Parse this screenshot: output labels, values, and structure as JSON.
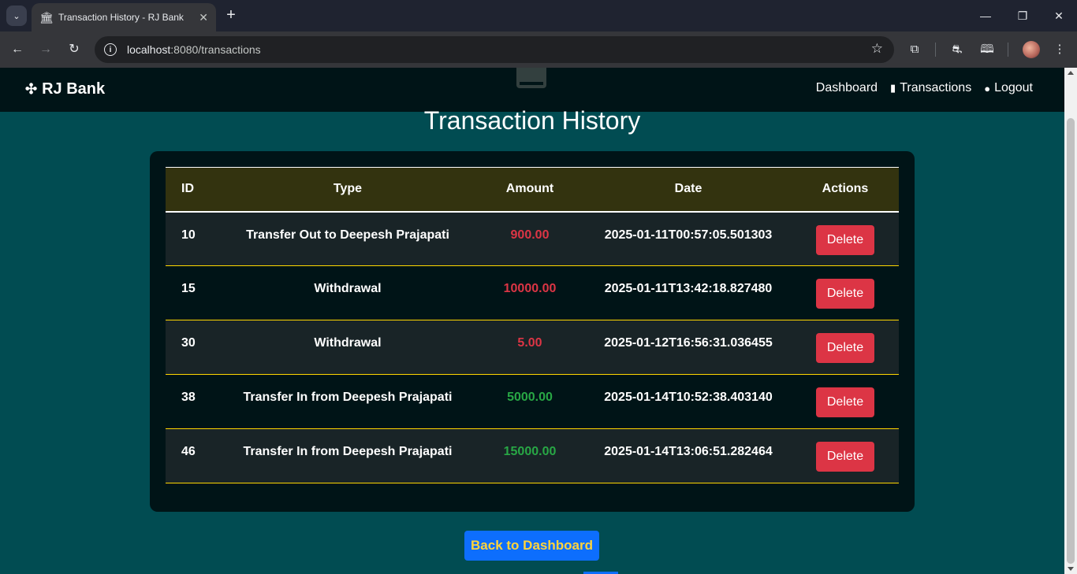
{
  "browser": {
    "tab_title": "Transaction History - RJ Bank",
    "url_host": "localhost",
    "url_rest": ":8080/transactions"
  },
  "navbar": {
    "brand": "RJ Bank",
    "links": {
      "dashboard": "Dashboard",
      "transactions": "Transactions",
      "logout": "Logout"
    }
  },
  "page": {
    "title": "Transaction History"
  },
  "table": {
    "headers": {
      "id": "ID",
      "type": "Type",
      "amount": "Amount",
      "date": "Date",
      "actions": "Actions"
    },
    "rows": [
      {
        "id": "10",
        "type": "Transfer Out to Deepesh Prajapati",
        "amount": "900.00",
        "date": "2025-01-11T00:57:05.501303",
        "action": "Delete"
      },
      {
        "id": "15",
        "type": "Withdrawal",
        "amount": "10000.00",
        "date": "2025-01-11T13:42:18.827480",
        "action": "Delete"
      },
      {
        "id": "30",
        "type": "Withdrawal",
        "amount": "5.00",
        "date": "2025-01-12T16:56:31.036455",
        "action": "Delete"
      },
      {
        "id": "38",
        "type": "Transfer In from Deepesh Prajapati",
        "amount": "5000.00",
        "date": "2025-01-14T10:52:38.403140",
        "action": "Delete"
      },
      {
        "id": "46",
        "type": "Transfer In from Deepesh Prajapati",
        "amount": "15000.00",
        "date": "2025-01-14T13:06:51.282464",
        "action": "Delete"
      }
    ]
  },
  "footer": {
    "back_label": "Back to Dashboard"
  },
  "colors": {
    "page_bg": "#014c52",
    "navbar_bg": "#001417",
    "card_bg": "#001417",
    "header_row_bg": "#33330f",
    "negative": "#dc3545",
    "positive": "#28a745",
    "delete_button": "#dc3545",
    "back_button": "#0d6efd",
    "back_button_text": "#ffd43b",
    "row_divider": "#ffd700"
  }
}
